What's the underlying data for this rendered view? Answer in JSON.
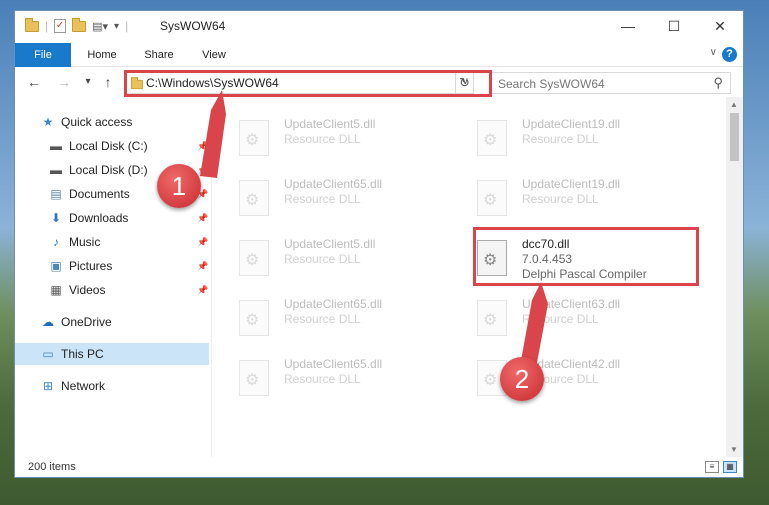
{
  "window": {
    "title": "SysWOW64",
    "minimize": "—",
    "maximize": "☐",
    "close": "✕"
  },
  "ribbon": {
    "tabs": [
      "File",
      "Home",
      "Share",
      "View"
    ],
    "help": "?"
  },
  "nav": {
    "back": "←",
    "forward": "→",
    "recent": "▾",
    "up": "↑",
    "address": "C:\\Windows\\SysWOW64",
    "refresh": "↻",
    "search_placeholder": "Search SysWOW64"
  },
  "sidebar": {
    "items": [
      {
        "label": "Quick access",
        "icon": "star-icon",
        "pinned": false
      },
      {
        "label": "Local Disk (C:)",
        "icon": "drive-icon",
        "pinned": true
      },
      {
        "label": "Local Disk (D:)",
        "icon": "drive-icon",
        "pinned": true
      },
      {
        "label": "Documents",
        "icon": "documents-icon",
        "pinned": true
      },
      {
        "label": "Downloads",
        "icon": "download-icon",
        "pinned": true
      },
      {
        "label": "Music",
        "icon": "music-icon",
        "pinned": true
      },
      {
        "label": "Pictures",
        "icon": "pictures-icon",
        "pinned": true
      },
      {
        "label": "Videos",
        "icon": "videos-icon",
        "pinned": true
      },
      {
        "label": "OneDrive",
        "icon": "cloud-icon",
        "pinned": false
      },
      {
        "label": "This PC",
        "icon": "computer-icon",
        "pinned": false,
        "selected": true
      },
      {
        "label": "Network",
        "icon": "network-icon",
        "pinned": false
      }
    ]
  },
  "files": [
    {
      "name": "UpdateClient5.dll",
      "type": "Resource DLL"
    },
    {
      "name": "UpdateClient19.dll",
      "type": "Resource DLL"
    },
    {
      "name": "UpdateClient65.dll",
      "type": "Resource DLL"
    },
    {
      "name": "UpdateClient19.dll",
      "type": "Resource DLL"
    },
    {
      "name": "UpdateClient5.dll",
      "type": "Resource DLL"
    },
    {
      "name": "dcc70.dll",
      "version": "7.0.4.453",
      "type": "Delphi Pascal Compiler",
      "highlighted": true
    },
    {
      "name": "UpdateClient65.dll",
      "type": "Resource DLL"
    },
    {
      "name": "UpdateClient63.dll",
      "type": "Resource DLL"
    },
    {
      "name": "UpdateClient65.dll",
      "type": "Resource DLL"
    },
    {
      "name": "UpdateClient42.dll",
      "type": "Resource DLL"
    }
  ],
  "status": {
    "item_count": "200 items"
  },
  "annotations": {
    "step1": "1",
    "step2": "2",
    "color": "#d9454b"
  }
}
